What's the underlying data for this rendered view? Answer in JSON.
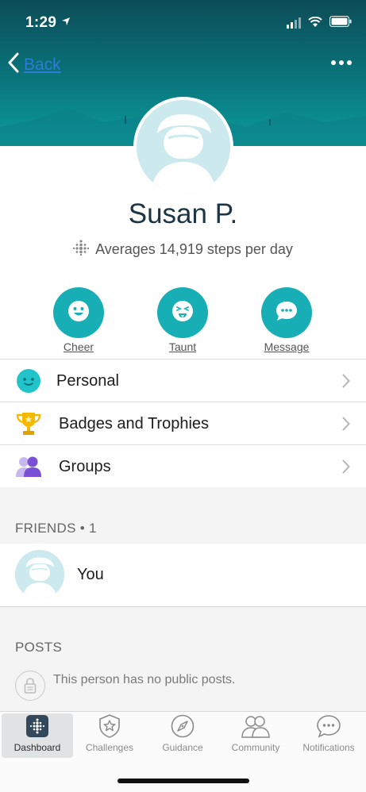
{
  "status_bar": {
    "time": "1:29"
  },
  "nav": {
    "back_label": "Back"
  },
  "profile": {
    "name": "Susan P.",
    "average_steps": "Averages 14,919 steps per day"
  },
  "actions": [
    {
      "label": "Cheer",
      "icon": "smile-icon"
    },
    {
      "label": "Taunt",
      "icon": "taunt-face-icon"
    },
    {
      "label": "Message",
      "icon": "chat-bubble-icon"
    }
  ],
  "menu": [
    {
      "label": "Personal",
      "icon": "personal-face-icon"
    },
    {
      "label": "Badges and Trophies",
      "icon": "trophy-icon"
    },
    {
      "label": "Groups",
      "icon": "groups-icon"
    }
  ],
  "friends": {
    "header": "FRIENDS • 1",
    "items": [
      {
        "name": "You"
      }
    ]
  },
  "posts": {
    "header": "POSTS",
    "empty_text": "This person has no public posts."
  },
  "tabbar": {
    "items": [
      {
        "label": "Dashboard",
        "active": true
      },
      {
        "label": "Challenges",
        "active": false
      },
      {
        "label": "Guidance",
        "active": false
      },
      {
        "label": "Community",
        "active": false
      },
      {
        "label": "Notifications",
        "active": false
      }
    ]
  },
  "colors": {
    "teal": "#17afb5",
    "link_blue": "#2f7bd8",
    "header_dark": "#0c4c58"
  }
}
